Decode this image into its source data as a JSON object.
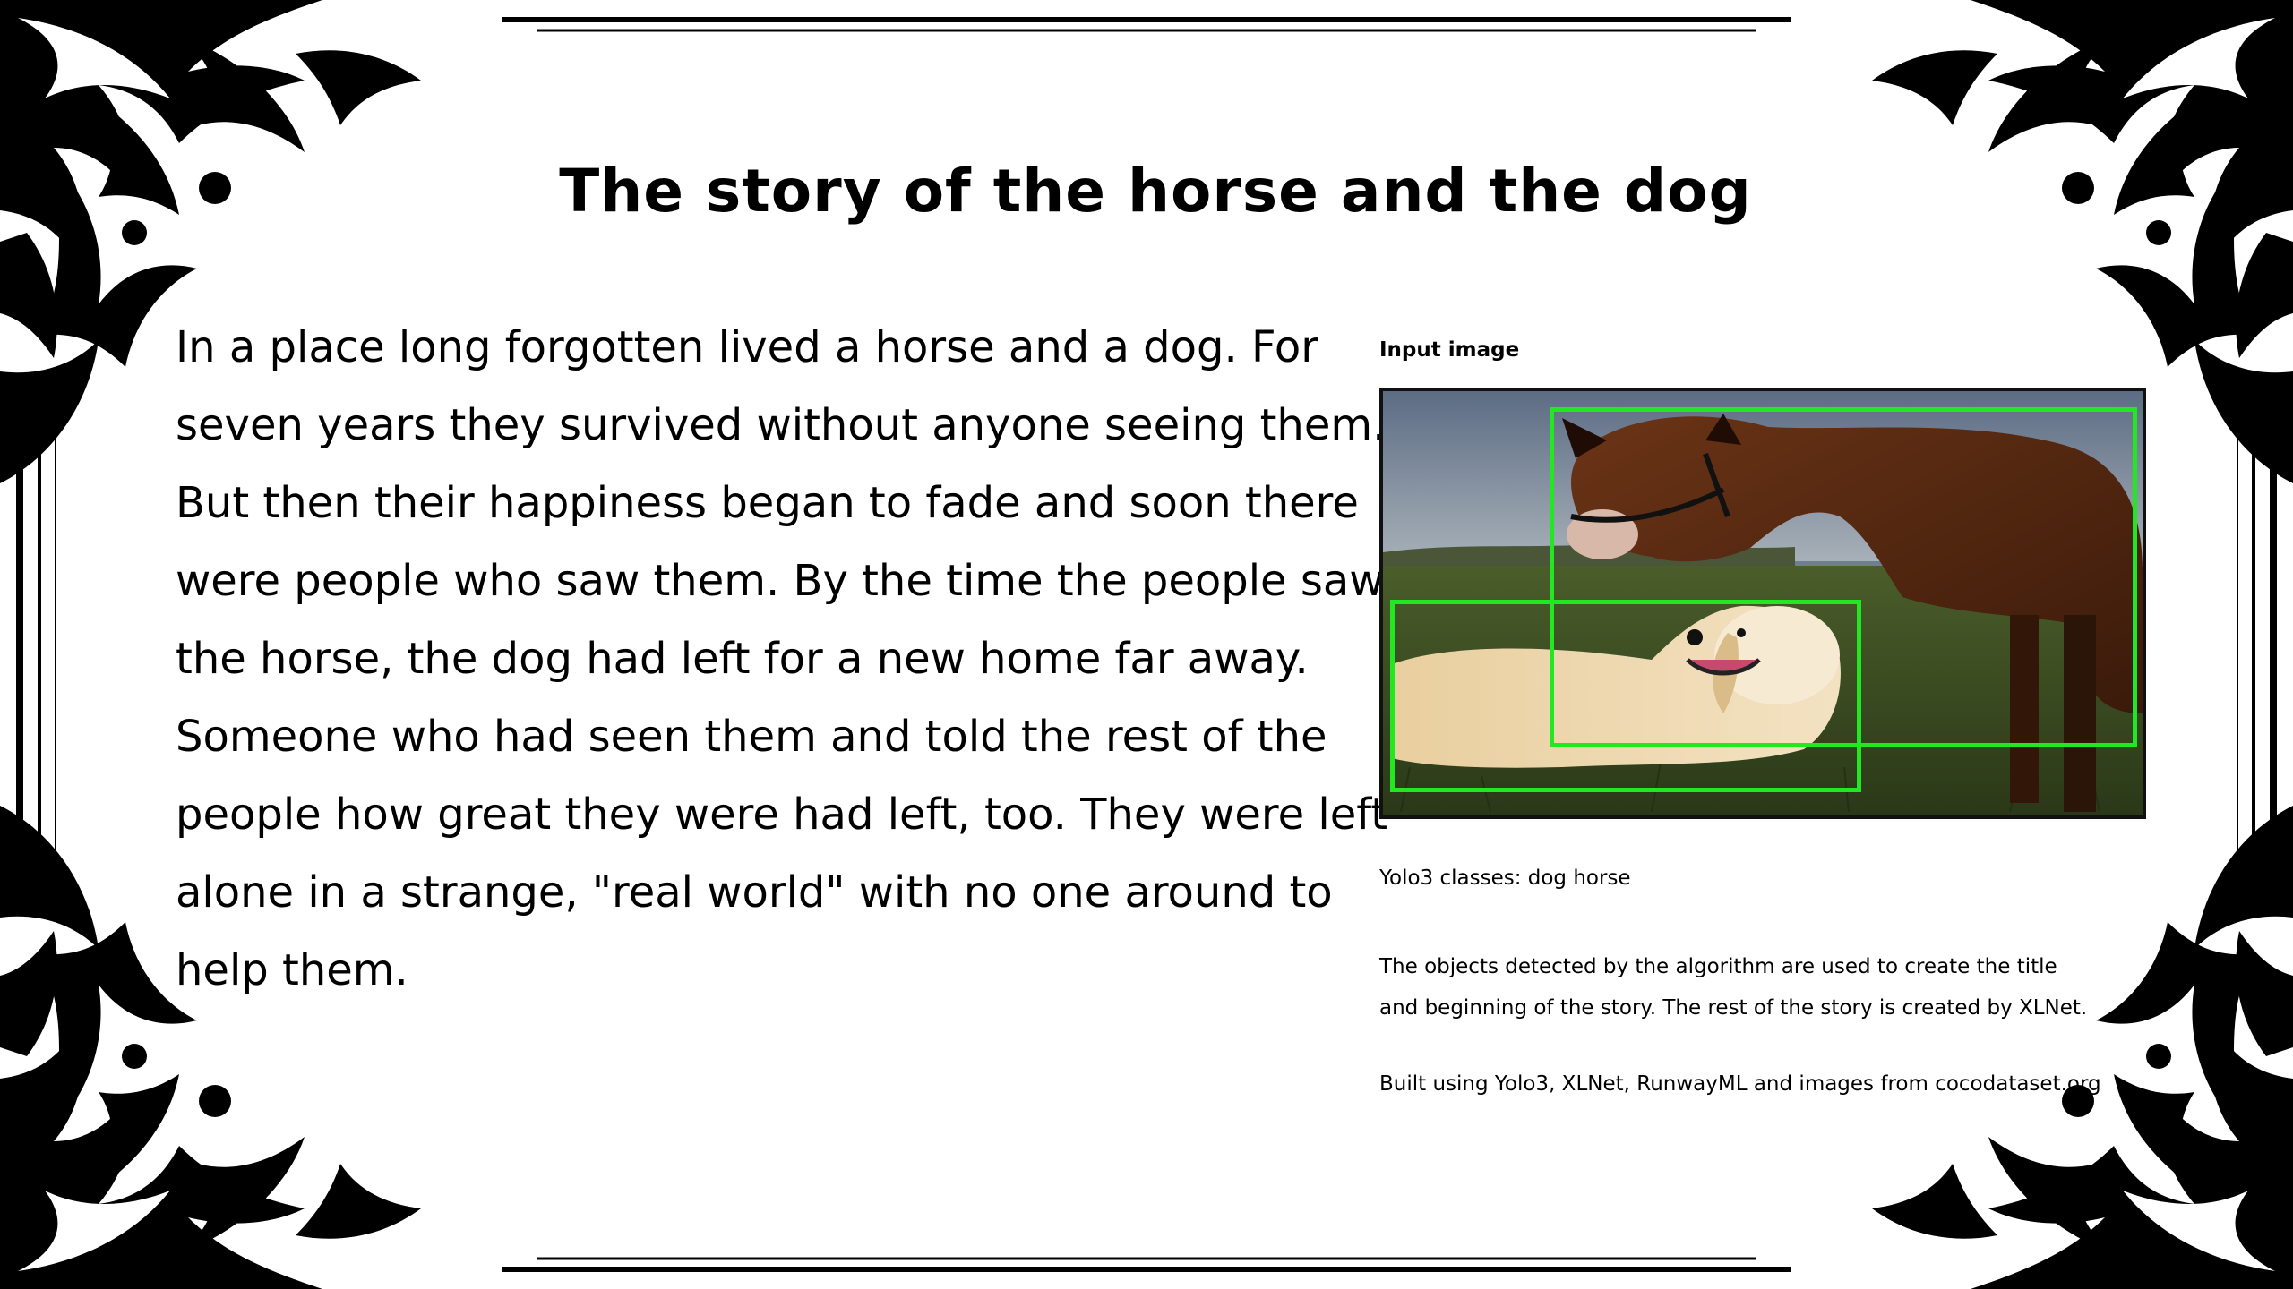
{
  "title": "The story of the horse and the dog",
  "story": {
    "lines": [
      "In a place long forgotten lived a horse and a dog. For",
      "seven years they survived without anyone seeing them.",
      "But then their happiness began to fade and soon there",
      "were people who saw them. By the time the people saw",
      "the horse, the dog had left for a new home far away.",
      "Someone who had seen them and told the rest of the",
      "people how great they were had left, too. They were left",
      "alone in a strange, \"real world\" with no one around to",
      "help them."
    ]
  },
  "input_image": {
    "label": "Input image",
    "box_color": "#22e822",
    "detected_objects": [
      "horse",
      "dog"
    ]
  },
  "classes": "Yolo3 classes: dog horse",
  "description": {
    "lines": [
      "The objects detected by the algorithm are used to create the title",
      "and beginning of the story. The rest of the story is created by XLNet."
    ]
  },
  "credits": "Built using Yolo3, XLNet, RunwayML and images from cocodataset.org",
  "frame": {
    "color": "#000000",
    "ornament": "floral-corner-flourish"
  }
}
